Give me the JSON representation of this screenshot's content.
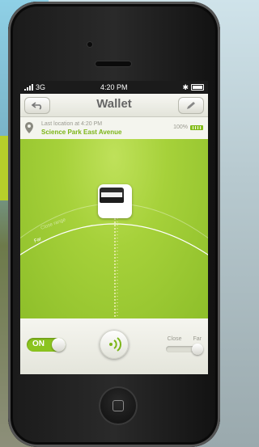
{
  "status_bar": {
    "carrier": "3G",
    "time": "4:20 PM"
  },
  "nav": {
    "title": "Wallet",
    "back_icon": "back-arrow-icon",
    "edit_icon": "pencil-icon"
  },
  "location": {
    "label": "Last location at 4:20 PM",
    "place": "Science Park East Avenue",
    "battery_percent": "100%"
  },
  "radar": {
    "inner_ring_label": "Close range",
    "outer_ring_label": "Far",
    "item_icon": "wallet-icon",
    "accent_color": "#8bc41f"
  },
  "controls": {
    "toggle_label": "ON",
    "toggle_state": "on",
    "signal_icon": "sound-waves-icon",
    "range_close_label": "Close",
    "range_far_label": "Far",
    "range_value": "Far"
  }
}
